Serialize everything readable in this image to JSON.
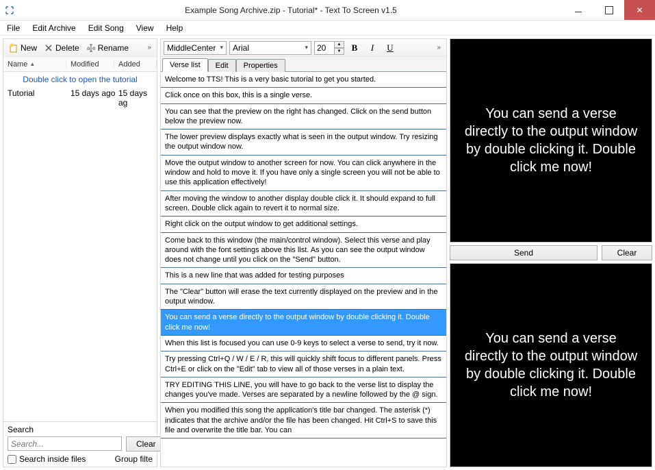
{
  "window": {
    "title": "Example Song Archive.zip - Tutorial* - Text To Screen v1.5"
  },
  "menubar": [
    "File",
    "Edit Archive",
    "Edit Song",
    "View",
    "Help"
  ],
  "left": {
    "toolbar": {
      "new": "New",
      "delete": "Delete",
      "rename": "Rename"
    },
    "cols": {
      "name": "Name",
      "modified": "Modified",
      "added": "Added"
    },
    "hint": "Double click to open the tutorial",
    "rows": [
      {
        "name": "Tutorial",
        "modified": "15 days ago",
        "added": "15 days ag"
      }
    ],
    "search": {
      "label": "Search",
      "placeholder": "Search...",
      "clear": "Clear",
      "inside": "Search inside files",
      "group": "Group filte"
    }
  },
  "mid": {
    "toolbar": {
      "align": "MiddleCenter",
      "font": "Arial",
      "size": "20"
    },
    "tabs": [
      "Verse list",
      "Edit",
      "Properties"
    ],
    "active_tab": 0,
    "verses": [
      "Welcome to TTS! This is a very basic tutorial to get you started.",
      "Click once on this box, this is a single verse.",
      "You can see that the preview on the right has changed. Click on the send button below the preview now.",
      "The lower preview displays exactly what is seen in the output window. Try resizing the output window now.",
      "Move the output window to another screen for now. You can click anywhere in the window and hold to move it. If you have only a single screen you will not be able to use this application effectively!",
      "After moving the window to another display double click it. It should expand to full screen. Double click again to revert it to normal size.",
      "Right click on the output window to get additional settings.",
      "Come back to this window (the main/control window).\nSelect this verse and play around with the font settings above this list. As you can see the output window does not change until you click on the \"Send\" button.",
      "This is a new line that was added for testing purposes",
      "The \"Clear\" button will erase the text currently displayed on the preview and in the output window.",
      "You can send a verse directly to the output window by double clicking it. Double click me now!",
      "When this list is focused you can use 0-9 keys to select a verse to send, try it now.",
      "Try pressing Ctrl+Q / W / E / R, this will quickly shift focus to different panels. Press Ctrl+E or click on the \"Edit\" tab to view all of those verses in a plain text.",
      "TRY EDITING THIS LINE, you will have to go back to the verse list to display the changes you've made. Verses are separated by a newline followed by the @ sign.",
      "When you modified this song the application's title bar changed. The asterisk (*) indicates that the archive and/or the file has been changed. Hit Ctrl+S to save this file and overwrite the title bar. You can"
    ],
    "selected": 10
  },
  "right": {
    "preview_top": "You can send a verse directly to the output window by double clicking it. Double click me now!",
    "send": "Send",
    "clear": "Clear",
    "preview_bottom": "You can send a verse directly to the output window by double clicking it. Double click me now!"
  }
}
